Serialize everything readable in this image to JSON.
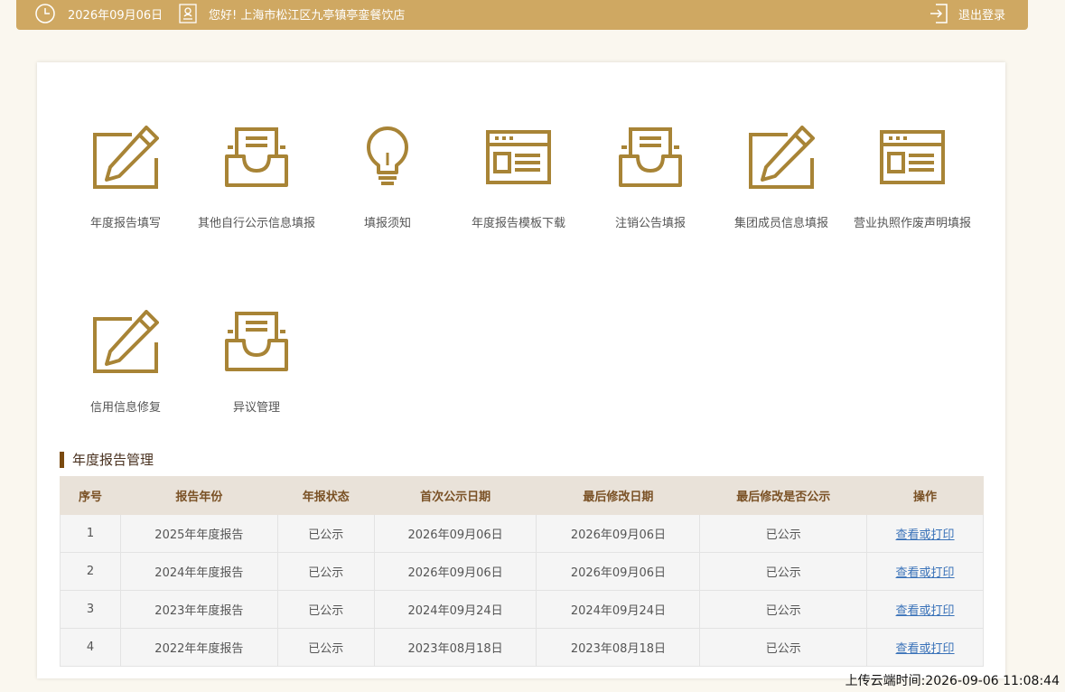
{
  "header": {
    "date": "2026年09月06日",
    "greeting": "您好!  上海市松江区九亭镇亭銮餐饮店",
    "logout_label": "退出登录",
    "icons": [
      "clock-icon",
      "user-badge-icon",
      "logout-icon"
    ]
  },
  "menu": {
    "items": [
      {
        "label": "年度报告填写",
        "icon": "pencil-edit-icon"
      },
      {
        "label": "其他自行公示信息填报",
        "icon": "inbox-tray-icon"
      },
      {
        "label": "填报须知",
        "icon": "lightbulb-icon"
      },
      {
        "label": "年度报告模板下载",
        "icon": "web-template-icon"
      },
      {
        "label": "注销公告填报",
        "icon": "inbox-tray-icon"
      },
      {
        "label": "集团成员信息填报",
        "icon": "pencil-edit-icon"
      },
      {
        "label": "营业执照作废声明填报",
        "icon": "web-template-icon"
      },
      {
        "label": "信用信息修复",
        "icon": "pencil-edit-icon"
      },
      {
        "label": "异议管理",
        "icon": "inbox-tray-icon"
      }
    ]
  },
  "reports": {
    "title": "年度报告管理",
    "columns": [
      "序号",
      "报告年份",
      "年报状态",
      "首次公示日期",
      "最后修改日期",
      "最后修改是否公示",
      "操作"
    ],
    "rows": [
      [
        "1",
        "2025年年度报告",
        "已公示",
        "2026年09月06日",
        "2026年09月06日",
        "已公示",
        "查看或打印"
      ],
      [
        "2",
        "2024年年度报告",
        "已公示",
        "2026年09月06日",
        "2026年09月06日",
        "已公示",
        "查看或打印"
      ],
      [
        "3",
        "2023年年度报告",
        "已公示",
        "2024年09月24日",
        "2024年09月24日",
        "已公示",
        "查看或打印"
      ],
      [
        "4",
        "2022年年度报告",
        "已公示",
        "2023年08月18日",
        "2023年08月18日",
        "已公示",
        "查看或打印"
      ]
    ]
  },
  "footer": {
    "upload_time": "上传云端时间:2026-09-06 11:08:44"
  },
  "colors": {
    "accent": "#cfa862",
    "icon_gold": "#a88436",
    "page_bg": "#faf7ef",
    "table_header_bg": "#e9e2d9",
    "link": "#3b73b9"
  }
}
